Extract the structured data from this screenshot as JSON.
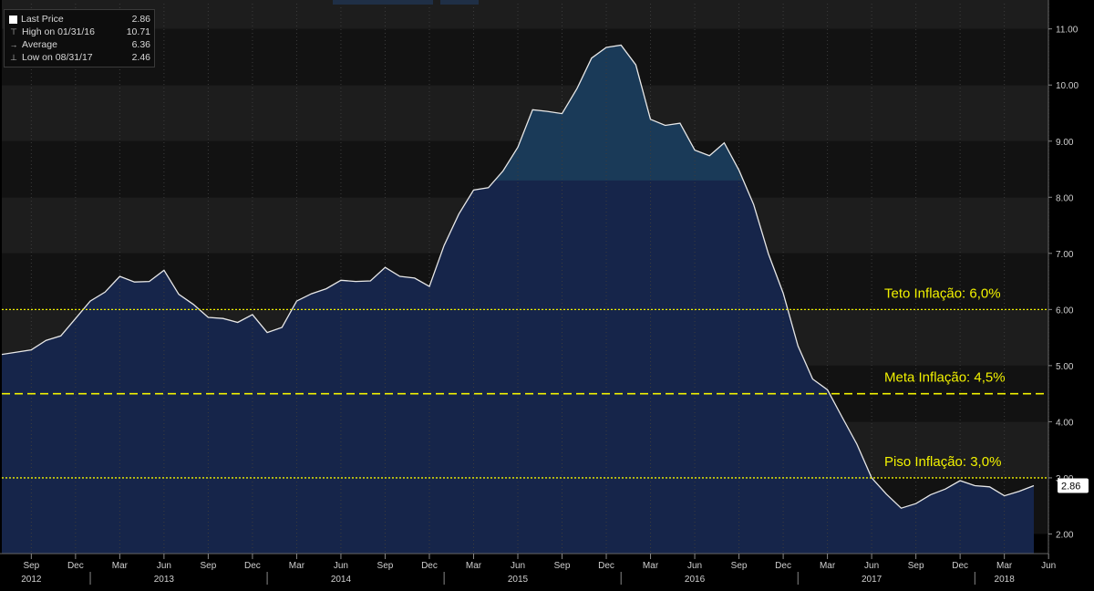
{
  "legend": {
    "items": [
      {
        "label": "Last Price",
        "value": "2.86",
        "icon": "square-marker-icon"
      },
      {
        "label": "High on 01/31/16",
        "value": "10.71",
        "icon": "high-marker-icon"
      },
      {
        "label": "Average",
        "value": "6.36",
        "icon": "average-marker-icon"
      },
      {
        "label": "Low on 08/31/17",
        "value": "2.46",
        "icon": "low-marker-icon"
      }
    ]
  },
  "colors": {
    "background": "#000000",
    "band_dark": "#121212",
    "band_mid": "#1d1d1d",
    "band_light": "#2c2c2c",
    "area_fill": "#16254a",
    "area_fill_upper": "#1a3a58",
    "line": "#e8e8e8",
    "reference_line": "#f2f200",
    "annotation_text": "#f2f200",
    "axis_text": "#cfcfcf",
    "last_price_box": "#ffffff"
  },
  "chart_data": {
    "type": "area",
    "x": [
      "2012-07",
      "2012-08",
      "2012-09",
      "2012-10",
      "2012-11",
      "2012-12",
      "2013-01",
      "2013-02",
      "2013-03",
      "2013-04",
      "2013-05",
      "2013-06",
      "2013-07",
      "2013-08",
      "2013-09",
      "2013-10",
      "2013-11",
      "2013-12",
      "2014-01",
      "2014-02",
      "2014-03",
      "2014-04",
      "2014-05",
      "2014-06",
      "2014-07",
      "2014-08",
      "2014-09",
      "2014-10",
      "2014-11",
      "2014-12",
      "2015-01",
      "2015-02",
      "2015-03",
      "2015-04",
      "2015-05",
      "2015-06",
      "2015-07",
      "2015-08",
      "2015-09",
      "2015-10",
      "2015-11",
      "2015-12",
      "2016-01",
      "2016-02",
      "2016-03",
      "2016-04",
      "2016-05",
      "2016-06",
      "2016-07",
      "2016-08",
      "2016-09",
      "2016-10",
      "2016-11",
      "2016-12",
      "2017-01",
      "2017-02",
      "2017-03",
      "2017-04",
      "2017-05",
      "2017-06",
      "2017-07",
      "2017-08",
      "2017-09",
      "2017-10",
      "2017-11",
      "2017-12",
      "2018-01",
      "2018-02",
      "2018-03",
      "2018-04",
      "2018-05"
    ],
    "series": [
      {
        "values": [
          5.2,
          5.24,
          5.28,
          5.45,
          5.53,
          5.84,
          6.15,
          6.31,
          6.59,
          6.49,
          6.5,
          6.7,
          6.27,
          6.09,
          5.86,
          5.84,
          5.77,
          5.91,
          5.59,
          5.68,
          6.15,
          6.28,
          6.37,
          6.52,
          6.5,
          6.51,
          6.75,
          6.59,
          6.56,
          6.41,
          7.14,
          7.7,
          8.13,
          8.17,
          8.47,
          8.89,
          9.56,
          9.53,
          9.49,
          9.93,
          10.48,
          10.67,
          10.71,
          10.36,
          9.39,
          9.28,
          9.32,
          8.84,
          8.74,
          8.97,
          8.48,
          7.87,
          6.99,
          6.29,
          5.35,
          4.76,
          4.57,
          4.08,
          3.6,
          3.0,
          2.71,
          2.46,
          2.54,
          2.7,
          2.8,
          2.95,
          2.86,
          2.84,
          2.68,
          2.76,
          2.86
        ]
      }
    ],
    "ylim": [
      1.65,
      11.45
    ],
    "yticks": [
      2.0,
      3.0,
      4.0,
      5.0,
      6.0,
      7.0,
      8.0,
      9.0,
      10.0,
      11.0
    ],
    "ytick_labels": [
      "2.00",
      "3.00",
      "4.00",
      "5.00",
      "6.00",
      "7.00",
      "8.00",
      "9.00",
      "10.00",
      "11.00"
    ],
    "x_month_ticks": [
      {
        "x": "2012-09",
        "label": "Sep"
      },
      {
        "x": "2012-12",
        "label": "Dec"
      },
      {
        "x": "2013-03",
        "label": "Mar"
      },
      {
        "x": "2013-06",
        "label": "Jun"
      },
      {
        "x": "2013-09",
        "label": "Sep"
      },
      {
        "x": "2013-12",
        "label": "Dec"
      },
      {
        "x": "2014-03",
        "label": "Mar"
      },
      {
        "x": "2014-06",
        "label": "Jun"
      },
      {
        "x": "2014-09",
        "label": "Sep"
      },
      {
        "x": "2014-12",
        "label": "Dec"
      },
      {
        "x": "2015-03",
        "label": "Mar"
      },
      {
        "x": "2015-06",
        "label": "Jun"
      },
      {
        "x": "2015-09",
        "label": "Sep"
      },
      {
        "x": "2015-12",
        "label": "Dec"
      },
      {
        "x": "2016-03",
        "label": "Mar"
      },
      {
        "x": "2016-06",
        "label": "Jun"
      },
      {
        "x": "2016-09",
        "label": "Sep"
      },
      {
        "x": "2016-12",
        "label": "Dec"
      },
      {
        "x": "2017-03",
        "label": "Mar"
      },
      {
        "x": "2017-06",
        "label": "Jun"
      },
      {
        "x": "2017-09",
        "label": "Sep"
      },
      {
        "x": "2017-12",
        "label": "Dec"
      },
      {
        "x": "2018-03",
        "label": "Mar"
      },
      {
        "x": "2018-06",
        "label": "Jun"
      }
    ],
    "x_year_labels": [
      {
        "x": "2012-09",
        "label": "2012"
      },
      {
        "x": "2013-06",
        "label": "2013"
      },
      {
        "x": "2014-06",
        "label": "2014"
      },
      {
        "x": "2015-06",
        "label": "2015"
      },
      {
        "x": "2016-06",
        "label": "2016"
      },
      {
        "x": "2017-06",
        "label": "2017"
      },
      {
        "x": "2018-03",
        "label": "2018"
      }
    ],
    "reference_lines": [
      {
        "value": 6.0,
        "label": "Teto Inflação: 6,0%",
        "style": "dotted"
      },
      {
        "value": 4.5,
        "label": "Meta Inflação: 4,5%",
        "style": "dashed"
      },
      {
        "value": 3.0,
        "label": "Piso Inflação: 3,0%",
        "style": "dotted"
      }
    ],
    "last_price_label": "2.86",
    "grid": true
  }
}
